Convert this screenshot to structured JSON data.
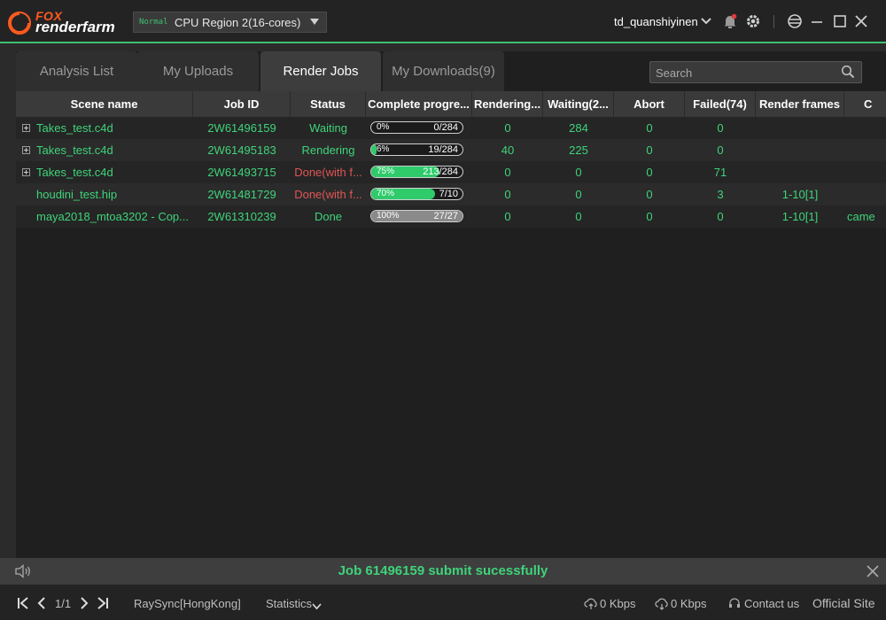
{
  "brand": {
    "top": "FOX",
    "bottom": "renderfarm"
  },
  "region": {
    "badge": "Normal",
    "label": "CPU Region 2(16-cores)"
  },
  "user": {
    "name": "td_quanshiyinen"
  },
  "tabs": [
    {
      "label": "Analysis List"
    },
    {
      "label": "My Uploads"
    },
    {
      "label": "Render Jobs"
    },
    {
      "label": "My Downloads(9)"
    }
  ],
  "search": {
    "placeholder": "Search"
  },
  "table": {
    "columns": [
      {
        "label": "Scene name"
      },
      {
        "label": "Job ID"
      },
      {
        "label": "Status"
      },
      {
        "label": "Complete progre..."
      },
      {
        "label": "Rendering..."
      },
      {
        "label": "Waiting(2..."
      },
      {
        "label": "Abort"
      },
      {
        "label": "Failed(74)"
      },
      {
        "label": "Render frames"
      },
      {
        "label": "C"
      }
    ],
    "rows": [
      {
        "scene": "Takes_test.c4d",
        "job_id": "2W61496159",
        "status": "Waiting",
        "status_color": "#3fd37a",
        "progress_pct": "0%",
        "progress_fraction": 0.0,
        "progress_count": "0/284",
        "rendering": "0",
        "waiting": "284",
        "abort": "0",
        "failed": "0",
        "frames": "",
        "camera": "",
        "expandable": true
      },
      {
        "scene": "Takes_test.c4d",
        "job_id": "2W61495183",
        "status": "Rendering",
        "status_color": "#3fd37a",
        "progress_pct": "6%",
        "progress_fraction": 0.06,
        "progress_count": "19/284",
        "rendering": "40",
        "waiting": "225",
        "abort": "0",
        "failed": "0",
        "frames": "",
        "camera": "",
        "expandable": true
      },
      {
        "scene": "Takes_test.c4d",
        "job_id": "2W61493715",
        "status": "Done(with f...",
        "status_color": "#e05555",
        "progress_pct": "75%",
        "progress_fraction": 0.75,
        "progress_count": "213/284",
        "rendering": "0",
        "waiting": "0",
        "abort": "0",
        "failed": "71",
        "frames": "",
        "camera": "",
        "expandable": true
      },
      {
        "scene": "houdini_test.hip",
        "job_id": "2W61481729",
        "status": "Done(with f...",
        "status_color": "#e05555",
        "progress_pct": "70%",
        "progress_fraction": 0.7,
        "progress_count": "7/10",
        "rendering": "0",
        "waiting": "0",
        "abort": "0",
        "failed": "3",
        "frames": "1-10[1]",
        "camera": "",
        "expandable": false
      },
      {
        "scene": "maya2018_mtoa3202 - Cop...",
        "job_id": "2W61310239",
        "status": "Done",
        "status_color": "#3fd37a",
        "progress_pct": "100%",
        "progress_fraction": 1.0,
        "progress_count": "27/27",
        "rendering": "0",
        "waiting": "0",
        "abort": "0",
        "failed": "0",
        "frames": "1-10[1]",
        "camera": "came",
        "expandable": false
      }
    ]
  },
  "notification": {
    "message": "Job 61496159 submit sucessfully"
  },
  "statusbar": {
    "page": "1/1",
    "raysync": "RaySync[HongKong]",
    "statistics": "Statistics",
    "upload_speed": "0 Kbps",
    "download_speed": "0 Kbps",
    "contact": "Contact us",
    "official": "Official Site"
  },
  "colors": {
    "accent": "#3fbf72",
    "brand_orange": "#ff5a1f",
    "error": "#e05555"
  }
}
